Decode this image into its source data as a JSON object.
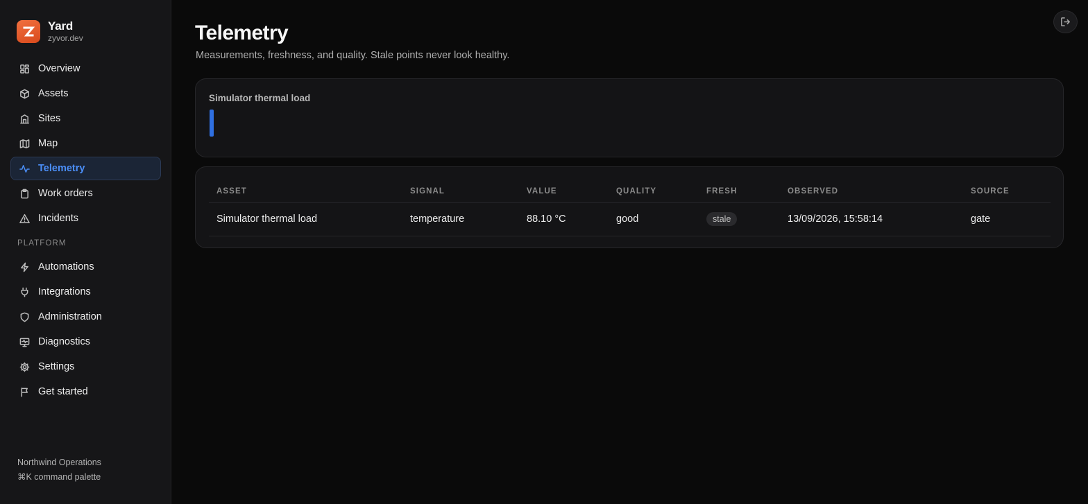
{
  "brand": {
    "name": "Yard",
    "domain": "zyvor.dev",
    "accent": "#e85d2a"
  },
  "nav": {
    "main_items": [
      {
        "label": "Overview",
        "icon": "dashboard-icon"
      },
      {
        "label": "Assets",
        "icon": "box-icon"
      },
      {
        "label": "Sites",
        "icon": "building-icon"
      },
      {
        "label": "Map",
        "icon": "map-icon"
      },
      {
        "label": "Telemetry",
        "icon": "activity-icon",
        "active": true
      },
      {
        "label": "Work orders",
        "icon": "clipboard-icon"
      },
      {
        "label": "Incidents",
        "icon": "warning-icon"
      }
    ],
    "section_label": "PLATFORM",
    "platform_items": [
      {
        "label": "Automations",
        "icon": "bolt-icon"
      },
      {
        "label": "Integrations",
        "icon": "plug-icon"
      },
      {
        "label": "Administration",
        "icon": "shield-icon"
      },
      {
        "label": "Diagnostics",
        "icon": "monitor-icon"
      },
      {
        "label": "Settings",
        "icon": "gear-icon"
      },
      {
        "label": "Get started",
        "icon": "flag-icon"
      }
    ]
  },
  "footer": {
    "org": "Northwind Operations",
    "shortcut": "⌘K command palette"
  },
  "page": {
    "title": "Telemetry",
    "subtitle": "Measurements, freshness, and quality. Stale points never look healthy."
  },
  "chart": {
    "title": "Simulator thermal load",
    "accent": "#2f6fe0"
  },
  "table": {
    "headers": [
      "ASSET",
      "SIGNAL",
      "VALUE",
      "QUALITY",
      "FRESH",
      "OBSERVED",
      "SOURCE"
    ],
    "rows": [
      {
        "asset": "Simulator thermal load",
        "signal": "temperature",
        "value": "88.10 °C",
        "quality": "good",
        "fresh": "stale",
        "observed": "13/09/2026, 15:58:14",
        "source": "gate"
      }
    ]
  },
  "active_color": "#4b8ef7"
}
